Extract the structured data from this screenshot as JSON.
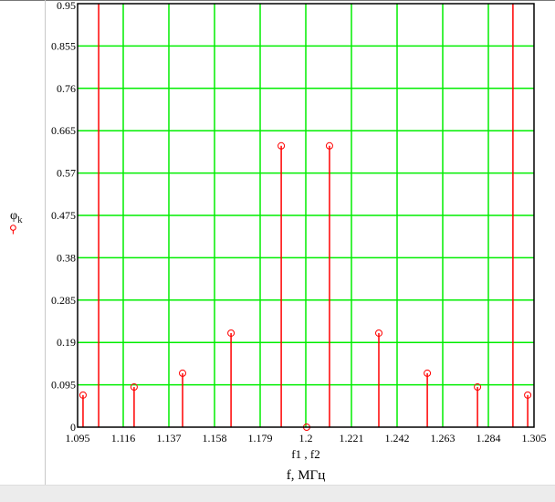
{
  "chart_data": {
    "type": "stem",
    "ylabel": "φ",
    "ylabel_sub": "k",
    "xlabel": "f1 , f2",
    "xunit_label": "f, МГц",
    "xlim": [
      1.095,
      1.305
    ],
    "ylim": [
      0,
      0.95
    ],
    "xticks": [
      "1.095",
      "1.116",
      "1.137",
      "1.158",
      "1.179",
      "1.2",
      "1.221",
      "1.242",
      "1.263",
      "1.284",
      "1.305"
    ],
    "yticks": [
      "0",
      "0.095",
      "0.19",
      "0.285",
      "0.38",
      "0.475",
      "0.57",
      "0.665",
      "0.76",
      "0.855",
      "0.95"
    ],
    "grid": true,
    "series": [
      {
        "name": "φk",
        "color": "#ff0000",
        "marker": "circle",
        "x": [
          1.0975,
          1.121,
          1.1433,
          1.1656,
          1.1887,
          1.2004,
          1.2109,
          1.2336,
          1.2559,
          1.279,
          1.3021
        ],
        "y": [
          0.072,
          0.09,
          0.121,
          0.211,
          0.631,
          0,
          0.631,
          0.211,
          0.121,
          0.09,
          0.072
        ]
      },
      {
        "name": "f2",
        "color": "#ff0000",
        "type": "vline",
        "x": [
          1.1047,
          1.2953
        ]
      }
    ],
    "colors": {
      "grid": "#00ee00",
      "axis": "#000000",
      "stem": "#ff0000"
    }
  }
}
